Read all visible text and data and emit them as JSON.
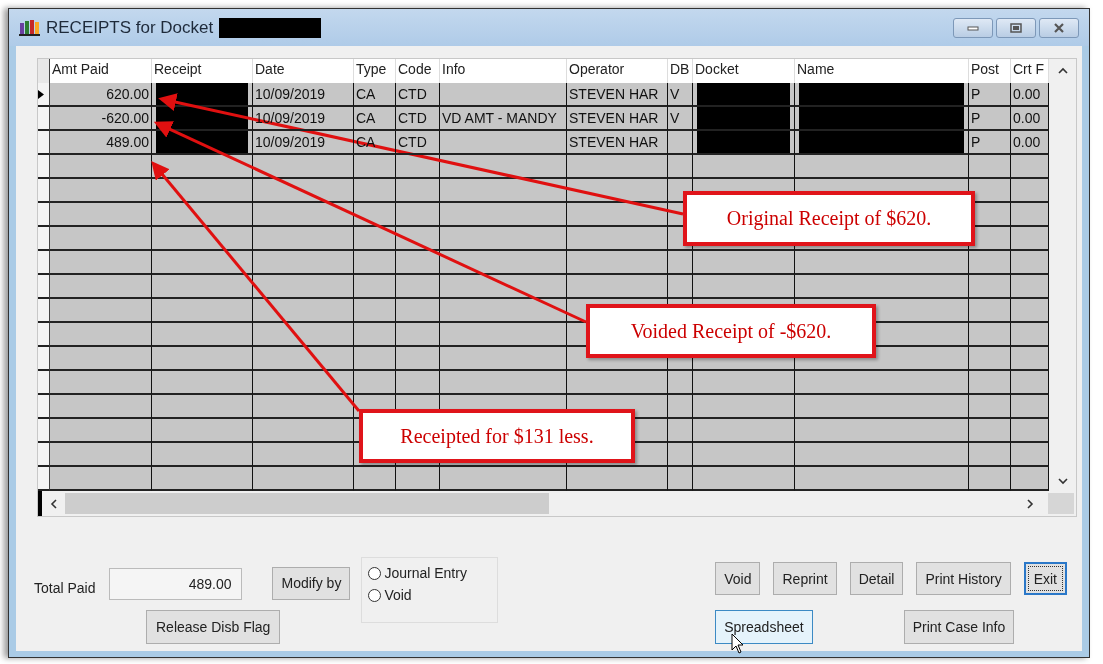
{
  "window": {
    "title": "RECEIPTS for Docket",
    "title_redacted": true
  },
  "grid": {
    "columns": [
      "Amt Paid",
      "Receipt",
      "Date",
      "Type",
      "Code",
      "Info",
      "Operator",
      "DB",
      "Docket",
      "Name",
      "Post",
      "Crt F"
    ],
    "rows": [
      {
        "current": true,
        "cells": [
          {
            "text": "620.00"
          },
          {
            "redacted": true
          },
          {
            "text": "10/09/2019"
          },
          {
            "text": "CA"
          },
          {
            "text": "CTD"
          },
          {},
          {
            "text": "STEVEN HAR"
          },
          {
            "text": "V"
          },
          {
            "redacted": true
          },
          {
            "redacted": true
          },
          {
            "text": "P"
          },
          {
            "text": "0.00"
          }
        ]
      },
      {
        "current": false,
        "cells": [
          {
            "text": "-620.00"
          },
          {
            "redacted": true
          },
          {
            "text": "10/09/2019"
          },
          {
            "text": "CA"
          },
          {
            "text": "CTD"
          },
          {
            "text": "VD AMT - MANDY"
          },
          {
            "text": "STEVEN HAR"
          },
          {
            "text": "V"
          },
          {
            "redacted": true
          },
          {
            "redacted": true
          },
          {
            "text": "P"
          },
          {
            "text": "0.00"
          }
        ]
      },
      {
        "current": false,
        "cells": [
          {
            "text": "489.00"
          },
          {
            "redacted": true
          },
          {
            "text": "10/09/2019"
          },
          {
            "text": "CA"
          },
          {
            "text": "CTD"
          },
          {},
          {
            "text": "STEVEN HAR"
          },
          {},
          {
            "redacted": true
          },
          {
            "redacted": true
          },
          {
            "text": "P"
          },
          {
            "text": "0.00"
          }
        ]
      }
    ]
  },
  "total_paid": {
    "label": "Total Paid",
    "value": "489.00"
  },
  "modify_button": "Modify by",
  "modify_options": [
    {
      "label": "Journal Entry",
      "selected": false
    },
    {
      "label": "Void",
      "selected": false
    }
  ],
  "release_button": "Release Disb Flag",
  "buttons_row1": [
    {
      "label": "Void",
      "focused": false
    },
    {
      "label": "Reprint",
      "focused": false
    },
    {
      "label": "Detail",
      "focused": false
    },
    {
      "label": "Print History",
      "focused": false
    },
    {
      "label": "Exit",
      "focused": true
    }
  ],
  "buttons_row2": [
    {
      "label": "Spreadsheet",
      "hovered": true
    },
    {
      "label": "Print Case Info",
      "hovered": false
    }
  ],
  "callouts": [
    {
      "text": "Original Receipt of $620."
    },
    {
      "text": "Voided Receipt of -$620."
    },
    {
      "text": "Receipted for $131 less."
    }
  ]
}
